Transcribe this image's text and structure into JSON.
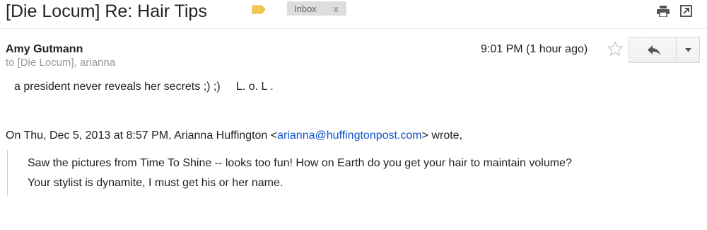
{
  "header": {
    "subject": "[Die Locum] Re: Hair Tips",
    "label_chip": "Inbox",
    "label_remove": "x",
    "label_color": "#f2c94c"
  },
  "message": {
    "sender": "Amy Gutmann",
    "recipients": "to [Die Locum], arianna",
    "timestamp": "9:01 PM (1 hour ago)",
    "body": "a president never reveals her secrets ;) ;)     L. o. L ."
  },
  "quote": {
    "intro": "On Thu, Dec 5, 2013 at 8:57 PM, Arianna Huffington <",
    "email": "arianna@huffingtonpost.com",
    "outro": "> wrote,",
    "lines": [
      "Saw the pictures from Time To Shine -- looks too fun! How on Earth do you get your hair to maintain volume?",
      "Your stylist is dynamite, I must get his or her name."
    ]
  },
  "icons": {
    "print": "print-icon",
    "popout": "popout-icon",
    "star": "star-icon",
    "reply": "reply-arrow-icon",
    "more": "chevron-down-icon",
    "label": "label-tag-icon"
  }
}
